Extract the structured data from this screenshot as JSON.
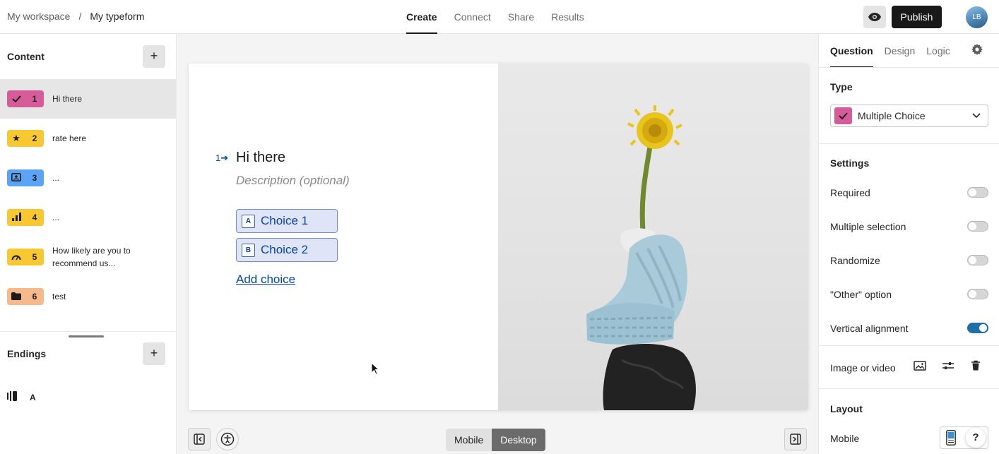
{
  "header": {
    "breadcrumb": [
      "My workspace",
      "/",
      "My typeform"
    ],
    "tabs": [
      {
        "label": "Create",
        "active": true
      },
      {
        "label": "Connect",
        "active": false
      },
      {
        "label": "Share",
        "active": false
      },
      {
        "label": "Results",
        "active": false
      }
    ],
    "publish_label": "Publish",
    "avatar_initials": "LB"
  },
  "content_panel": {
    "heading": "Content",
    "add_label": "+",
    "questions": [
      {
        "number": "1",
        "label": "Hi there",
        "icon": "check-icon",
        "color": "#d65c99",
        "selected": true
      },
      {
        "number": "2",
        "label": "rate here",
        "icon": "star-icon",
        "color": "#f7c832",
        "selected": false
      },
      {
        "number": "3",
        "label": "...",
        "icon": "contact-card-icon",
        "color": "#5ba4f5",
        "selected": false
      },
      {
        "number": "4",
        "label": "...",
        "icon": "bar-chart-icon",
        "color": "#f7c832",
        "selected": false
      },
      {
        "number": "5",
        "label": "How likely are you to recommend us...",
        "icon": "gauge-icon",
        "color": "#f7c832",
        "selected": false
      },
      {
        "number": "6",
        "label": "test",
        "icon": "folder-icon",
        "color": "#f6b98a",
        "selected": false
      }
    ],
    "endings_heading": "Endings",
    "endings_add_label": "+",
    "ending_item": {
      "icon": "ending-icon",
      "label": "A"
    }
  },
  "canvas": {
    "question_number": "1",
    "question_title": "Hi there",
    "description_placeholder": "Description (optional)",
    "choices": [
      {
        "key": "A",
        "label": "Choice 1"
      },
      {
        "key": "B",
        "label": "Choice 2"
      }
    ],
    "add_choice_label": "Add choice",
    "device_toggle": {
      "mobile": "Mobile",
      "desktop": "Desktop",
      "active": "Desktop"
    }
  },
  "right_panel": {
    "tabs": [
      {
        "label": "Question",
        "active": true
      },
      {
        "label": "Design",
        "active": false
      },
      {
        "label": "Logic",
        "active": false
      }
    ],
    "type_heading": "Type",
    "type_value": "Multiple Choice",
    "settings_heading": "Settings",
    "settings": [
      {
        "label": "Required",
        "on": false
      },
      {
        "label": "Multiple selection",
        "on": false
      },
      {
        "label": "Randomize",
        "on": false
      },
      {
        "label": "\"Other\" option",
        "on": false
      },
      {
        "label": "Vertical alignment",
        "on": true
      }
    ],
    "media_label": "Image or video",
    "layout_heading": "Layout",
    "layout_mobile_label": "Mobile",
    "help_label": "?"
  },
  "colors": {
    "accent": "#0445af",
    "publish_bg": "#191919",
    "toggle_on": "#1e6fa8"
  }
}
